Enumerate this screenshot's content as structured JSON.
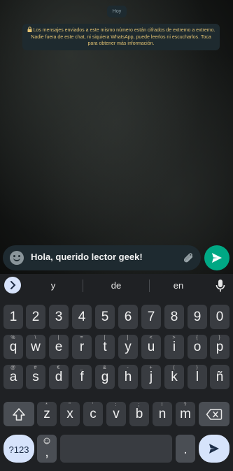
{
  "chat": {
    "date_chip": "Hoy",
    "notice_lock_icon": "lock-icon",
    "notice_text": "Los mensajes enviados a este mismo número están cifrados de extremo a extremo. Nadie fuera de este chat, ni siquiera WhatsApp, puede leerlos ni escucharlos. Toca para obtener más información.",
    "notice_color": "#e4c372"
  },
  "composer": {
    "text": "Hola, querido lector geek!",
    "emoji_icon": "emoji-icon",
    "attach_icon": "paperclip-icon",
    "send_icon": "send-icon",
    "send_color": "#00a884"
  },
  "keyboard": {
    "suggestions": [
      "y",
      "de",
      "en"
    ],
    "expand_icon": "chevron-right-icon",
    "mic_icon": "mic-icon",
    "number_row": [
      "1",
      "2",
      "3",
      "4",
      "5",
      "6",
      "7",
      "8",
      "9",
      "0"
    ],
    "row1": [
      {
        "key": "q",
        "sup": "%"
      },
      {
        "key": "w",
        "sup": "\\"
      },
      {
        "key": "e",
        "sup": "|"
      },
      {
        "key": "r",
        "sup": "="
      },
      {
        "key": "t",
        "sup": "["
      },
      {
        "key": "y",
        "sup": "]"
      },
      {
        "key": "u",
        "sup": "<"
      },
      {
        "key": "i",
        "sup": ">"
      },
      {
        "key": "o",
        "sup": "{"
      },
      {
        "key": "p",
        "sup": "}"
      }
    ],
    "row2": [
      {
        "key": "a",
        "sup": "@"
      },
      {
        "key": "s",
        "sup": "#"
      },
      {
        "key": "d",
        "sup": "€"
      },
      {
        "key": "f",
        "sup": "_"
      },
      {
        "key": "g",
        "sup": "&"
      },
      {
        "key": "h",
        "sup": "-"
      },
      {
        "key": "j",
        "sup": "+"
      },
      {
        "key": "k",
        "sup": "("
      },
      {
        "key": "l",
        "sup": ")"
      },
      {
        "key": "ñ",
        "sup": ""
      }
    ],
    "row3": [
      {
        "key": "z",
        "sup": "*"
      },
      {
        "key": "x",
        "sup": "\""
      },
      {
        "key": "c",
        "sup": "'"
      },
      {
        "key": "v",
        "sup": ":"
      },
      {
        "key": "b",
        "sup": ";"
      },
      {
        "key": "n",
        "sup": "!"
      },
      {
        "key": "m",
        "sup": "?"
      }
    ],
    "shift_icon": "shift-icon",
    "backspace_icon": "backspace-icon",
    "symbols_label": "?123",
    "comma_label": ",",
    "comma_emoji_icon": "emoji-icon",
    "period_label": ".",
    "enter_icon": "send-icon",
    "accent_color": "#d6e3fb"
  }
}
